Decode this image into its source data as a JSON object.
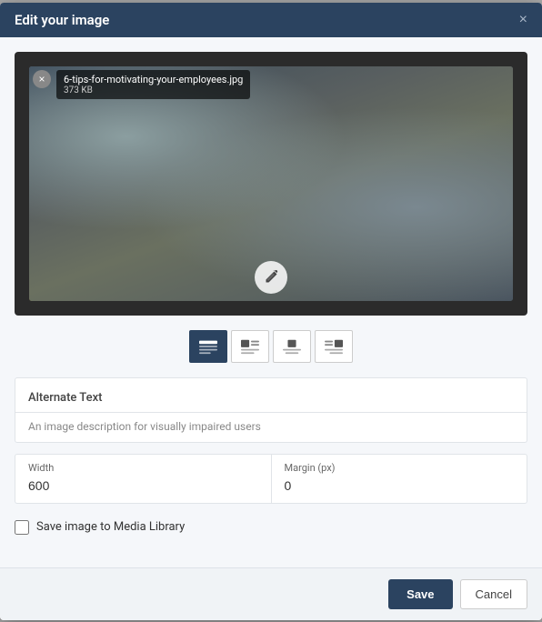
{
  "modal": {
    "title": "Edit your image",
    "close_label": "×"
  },
  "image": {
    "filename": "6-tips-for-motivating-your-employees.jpg",
    "filesize": "373 KB",
    "remove_btn_label": "×",
    "edit_icon": "✎"
  },
  "alignment": {
    "buttons": [
      {
        "id": "full",
        "label": "full-width",
        "active": true
      },
      {
        "id": "left",
        "label": "align-left",
        "active": false
      },
      {
        "id": "center",
        "label": "align-center",
        "active": false
      },
      {
        "id": "right",
        "label": "align-right",
        "active": false
      }
    ]
  },
  "fields": {
    "alternate_text": {
      "label": "Alternate Text",
      "hint": "An image description for visually impaired users"
    },
    "width": {
      "label": "Width",
      "value": "600"
    },
    "margin": {
      "label": "Margin (px)",
      "value": "0"
    }
  },
  "save_library": {
    "label": "Save image to Media Library"
  },
  "footer": {
    "save_label": "Save",
    "cancel_label": "Cancel"
  }
}
